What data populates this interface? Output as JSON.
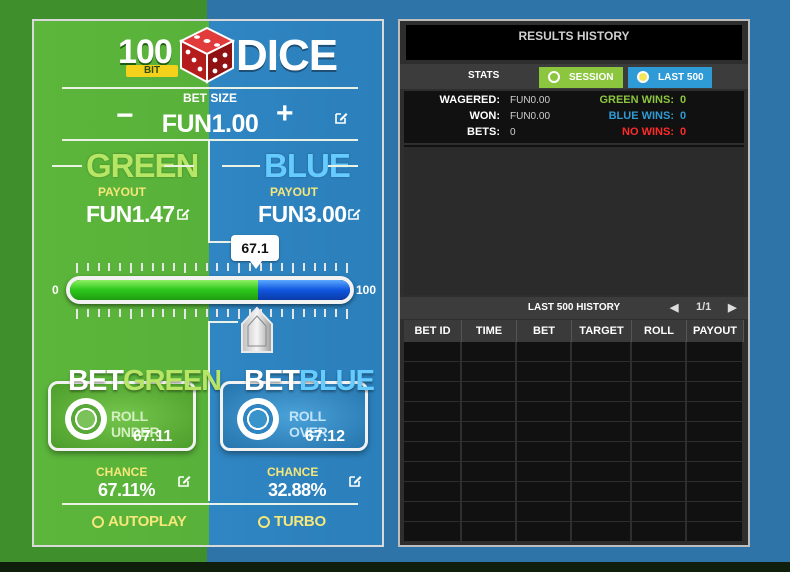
{
  "logo": {
    "hundred": "100",
    "bit": "BIT",
    "dice": "DICE"
  },
  "bet_size": {
    "label": "BET SIZE",
    "minus": "−",
    "plus": "+",
    "value": "FUN1.00"
  },
  "green": {
    "title": "GREEN",
    "payout_label": "PAYOUT",
    "payout_value": "FUN1.47",
    "bet_word": "BET",
    "bet_color_word": "GREEN",
    "roll_label": "ROLL UNDER",
    "roll_value": "67.11",
    "chance_label": "CHANCE",
    "chance_value": "67.11%"
  },
  "blue": {
    "title": "BLUE",
    "payout_label": "PAYOUT",
    "payout_value": "FUN3.00",
    "bet_word": "BET",
    "bet_color_word": "BLUE",
    "roll_label": "ROLL OVER",
    "roll_value": "67.12",
    "chance_label": "CHANCE",
    "chance_value": "32.88%"
  },
  "slider": {
    "min": "0",
    "max": "100",
    "value_label": "67.1",
    "value": 67.1
  },
  "options": {
    "autoplay": "AUTOPLAY",
    "turbo": "TURBO"
  },
  "results": {
    "title": "RESULTS HISTORY",
    "stats_label": "STATS",
    "tab_session": "SESSION",
    "tab_last500": "LAST 500",
    "wagered_label": "WAGERED:",
    "wagered_value": "FUN0.00",
    "won_label": "WON:",
    "won_value": "FUN0.00",
    "bets_label": "BETS:",
    "bets_value": "0",
    "green_wins_label": "GREEN WINS:",
    "green_wins_value": "0",
    "blue_wins_label": "BLUE WINS:",
    "blue_wins_value": "0",
    "no_wins_label": "NO WINS:",
    "no_wins_value": "0",
    "history_title": "LAST 500 HISTORY",
    "page_prev": "◀",
    "page_indicator": "1/1",
    "page_next": "▶",
    "columns": [
      "BET ID",
      "TIME",
      "BET",
      "TARGET",
      "ROLL",
      "PAYOUT"
    ]
  },
  "colors": {
    "green_accent": "#b7e565",
    "blue_accent": "#66cbff",
    "gold": "#f6e77a",
    "green_win": "#8cc63f",
    "blue_win": "#2e9bd6",
    "no_win": "#ff2a2a"
  }
}
